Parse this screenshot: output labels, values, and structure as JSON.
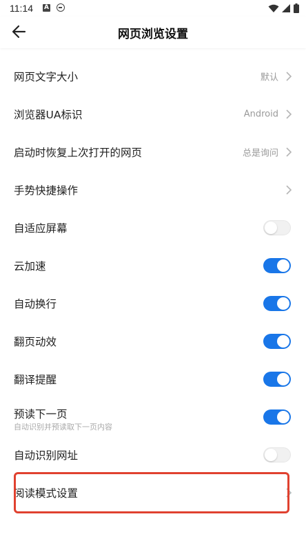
{
  "status_bar": {
    "time": "11:14",
    "icons": [
      "a-box-icon",
      "e-circle-icon",
      "wifi-icon",
      "signal-icon",
      "battery-icon"
    ]
  },
  "header": {
    "title": "网页浏览设置",
    "back_icon": "arrow-left-icon"
  },
  "settings": {
    "font_size": {
      "label": "网页文字大小",
      "value": "默认"
    },
    "user_agent": {
      "label": "浏览器UA标识",
      "value": "Android"
    },
    "restore_pages": {
      "label": "启动时恢复上次打开的网页",
      "value": "总是询问"
    },
    "gestures": {
      "label": "手势快捷操作"
    },
    "fit_screen": {
      "label": "自适应屏幕",
      "enabled": false
    },
    "cloud_accel": {
      "label": "云加速",
      "enabled": true
    },
    "auto_wrap": {
      "label": "自动换行",
      "enabled": true
    },
    "page_animation": {
      "label": "翻页动效",
      "enabled": true
    },
    "translate_hint": {
      "label": "翻译提醒",
      "enabled": true
    },
    "preload": {
      "label": "预读下一页",
      "sublabel": "自动识别并预读取下一页内容",
      "enabled": true
    },
    "auto_detect_url": {
      "label": "自动识别网址",
      "enabled": false
    },
    "reading_mode": {
      "label": "阅读模式设置"
    }
  },
  "colors": {
    "toggle_on": "#1976e8",
    "toggle_off": "#f1f1f1",
    "highlight": "#e0412f",
    "secondary_text": "#9a9a9a"
  }
}
